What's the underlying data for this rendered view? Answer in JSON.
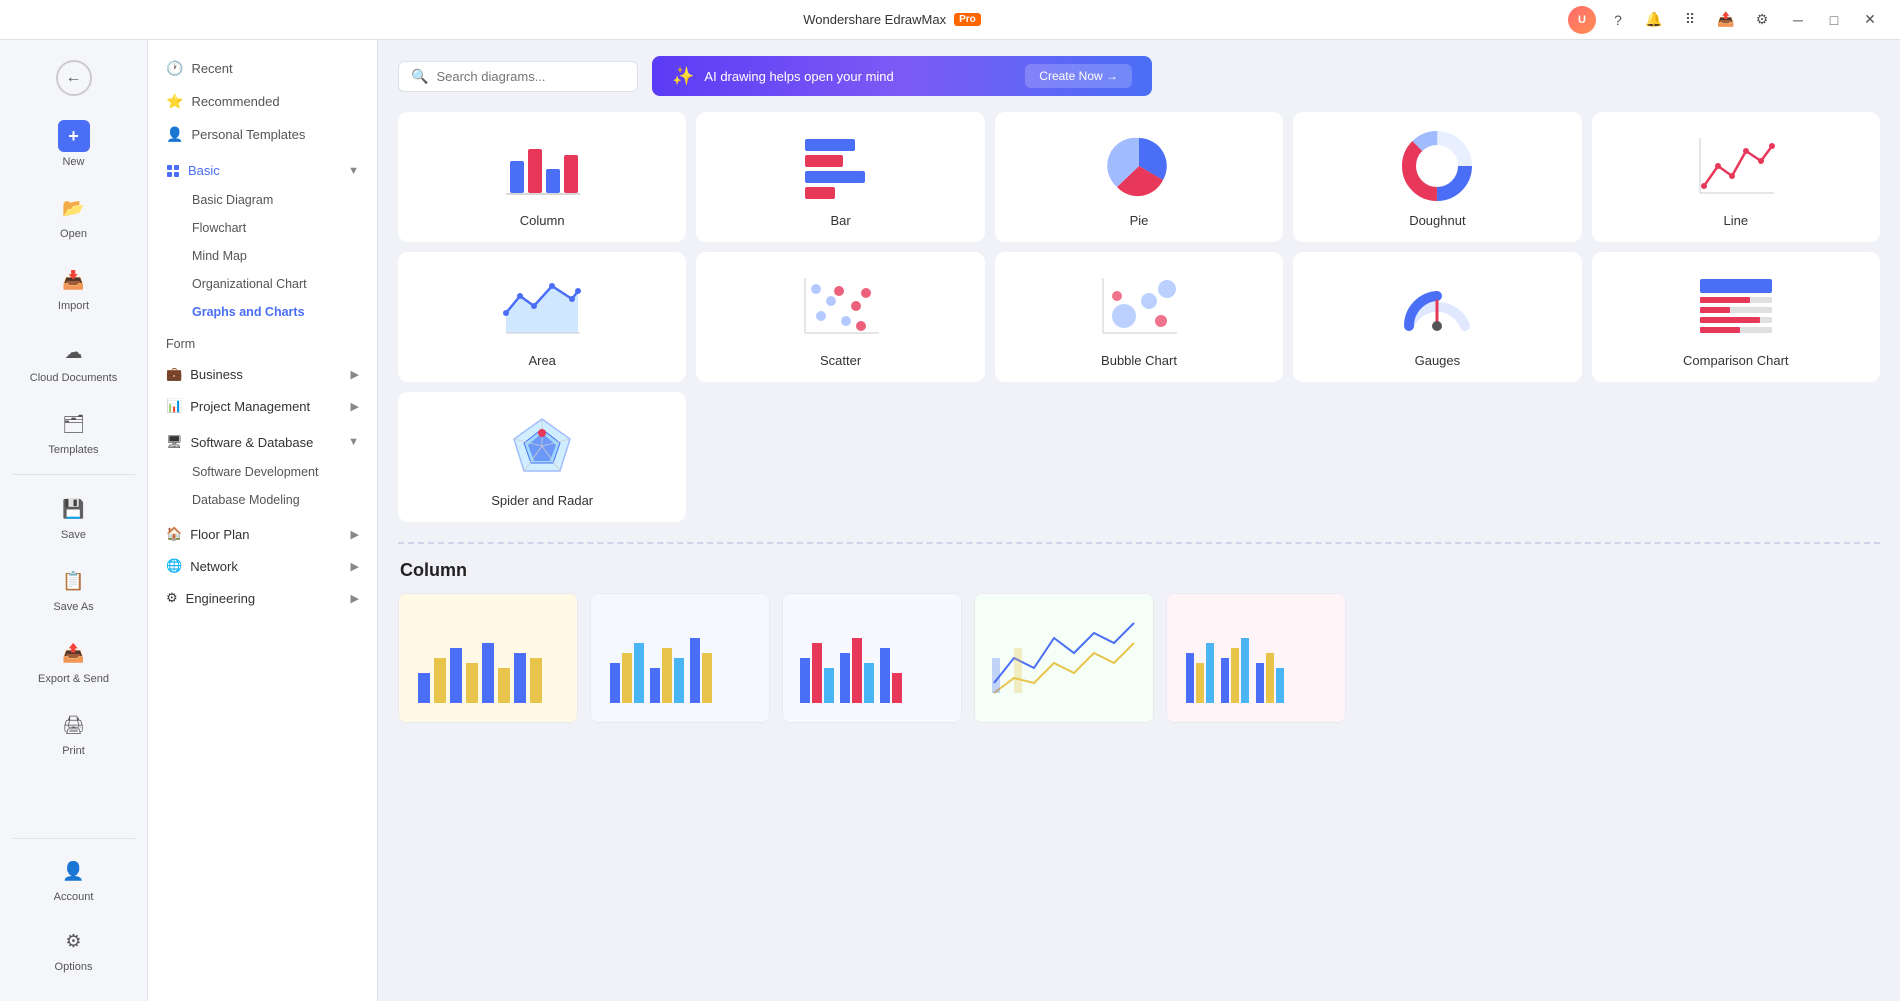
{
  "titleBar": {
    "appName": "Wondershare EdrawMax",
    "badgeText": "Pro",
    "windowButtons": [
      "minimize",
      "maximize",
      "close"
    ],
    "topIcons": [
      "help",
      "notification",
      "apps",
      "share",
      "settings"
    ]
  },
  "leftSidebar": {
    "backButton": "←",
    "items": [
      {
        "id": "new",
        "label": "New",
        "icon": "+"
      },
      {
        "id": "open",
        "label": "Open",
        "icon": "📁"
      },
      {
        "id": "import",
        "label": "Import",
        "icon": "📥"
      },
      {
        "id": "cloud",
        "label": "Cloud Documents",
        "icon": "☁"
      },
      {
        "id": "templates",
        "label": "Templates",
        "icon": "🗂"
      },
      {
        "id": "save",
        "label": "Save",
        "icon": "💾"
      },
      {
        "id": "saveas",
        "label": "Save As",
        "icon": "📋"
      },
      {
        "id": "export",
        "label": "Export & Send",
        "icon": "📤"
      },
      {
        "id": "print",
        "label": "Print",
        "icon": "🖨"
      }
    ],
    "bottomItems": [
      {
        "id": "account",
        "label": "Account",
        "icon": "👤"
      },
      {
        "id": "options",
        "label": "Options",
        "icon": "⚙"
      }
    ]
  },
  "navPanel": {
    "items": [
      {
        "id": "recent",
        "label": "Recent",
        "icon": "🕐",
        "type": "item"
      },
      {
        "id": "recommended",
        "label": "Recommended",
        "icon": "⭐",
        "type": "item"
      },
      {
        "id": "personal",
        "label": "Personal Templates",
        "icon": "👤",
        "type": "item"
      },
      {
        "id": "basic",
        "label": "Basic",
        "icon": "◻",
        "type": "section",
        "expanded": true,
        "children": [
          {
            "id": "basic-diagram",
            "label": "Basic Diagram"
          },
          {
            "id": "flowchart",
            "label": "Flowchart"
          },
          {
            "id": "mind-map",
            "label": "Mind Map"
          },
          {
            "id": "org-chart",
            "label": "Organizational Chart"
          },
          {
            "id": "graphs-charts",
            "label": "Graphs and Charts",
            "active": true
          }
        ]
      },
      {
        "id": "form",
        "label": "Form",
        "icon": "📋",
        "type": "sub-only"
      },
      {
        "id": "business",
        "label": "Business",
        "icon": "💼",
        "type": "section",
        "expanded": false
      },
      {
        "id": "project-mgmt",
        "label": "Project Management",
        "icon": "📊",
        "type": "section",
        "expanded": false
      },
      {
        "id": "software-db",
        "label": "Software & Database",
        "icon": "🖥",
        "type": "section",
        "expanded": true,
        "children": [
          {
            "id": "software-dev",
            "label": "Software Development"
          },
          {
            "id": "db-modeling",
            "label": "Database Modeling"
          }
        ]
      },
      {
        "id": "floor-plan",
        "label": "Floor Plan",
        "icon": "🏠",
        "type": "section",
        "expanded": false
      },
      {
        "id": "network",
        "label": "Network",
        "icon": "🌐",
        "type": "section",
        "expanded": false
      },
      {
        "id": "engineering",
        "label": "Engineering",
        "icon": "⚙",
        "type": "section",
        "expanded": false
      }
    ]
  },
  "contentArea": {
    "searchPlaceholder": "Search diagrams...",
    "aiBannerText": "AI drawing helps open your mind",
    "createNowLabel": "Create Now →",
    "chartCards": [
      {
        "id": "column",
        "label": "Column"
      },
      {
        "id": "bar",
        "label": "Bar"
      },
      {
        "id": "pie",
        "label": "Pie"
      },
      {
        "id": "doughnut",
        "label": "Doughnut"
      },
      {
        "id": "line",
        "label": "Line"
      },
      {
        "id": "area",
        "label": "Area"
      },
      {
        "id": "scatter",
        "label": "Scatter"
      },
      {
        "id": "bubble",
        "label": "Bubble Chart"
      },
      {
        "id": "gauges",
        "label": "Gauges"
      },
      {
        "id": "comparison",
        "label": "Comparison Chart"
      },
      {
        "id": "spider",
        "label": "Spider and Radar"
      }
    ],
    "sectionTitle": "Column",
    "templateCards": [
      {
        "id": "t1",
        "bg": "#fff9e6"
      },
      {
        "id": "t2",
        "bg": "#e8f4e8"
      },
      {
        "id": "t3",
        "bg": "#fff0e8"
      },
      {
        "id": "t4",
        "bg": "#e8eeff"
      },
      {
        "id": "t5",
        "bg": "#ffeef0"
      }
    ]
  }
}
